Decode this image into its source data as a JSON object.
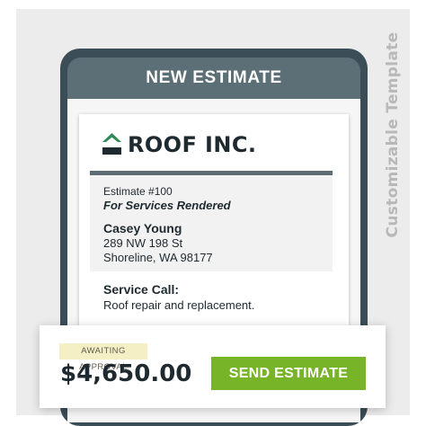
{
  "side_label": "Customizable Template",
  "header": {
    "title": "NEW ESTIMATE"
  },
  "company": {
    "name": "ROOF INC.",
    "logo_icon": "house-roof-icon",
    "logo_color": "#2e8b57"
  },
  "estimate": {
    "number": "Estimate #100",
    "subtitle": "For Services Rendered"
  },
  "customer": {
    "name": "Casey Young",
    "address_line1": "289 NW 198 St",
    "address_line2": "Shoreline, WA 98177"
  },
  "service": {
    "title": "Service Call:",
    "description": "Roof repair and replacement."
  },
  "footer": {
    "status_badge": "AWAITING APPROVAL",
    "total": "$4,650.00",
    "send_label": "SEND ESTIMATE",
    "send_color": "#78b427"
  }
}
